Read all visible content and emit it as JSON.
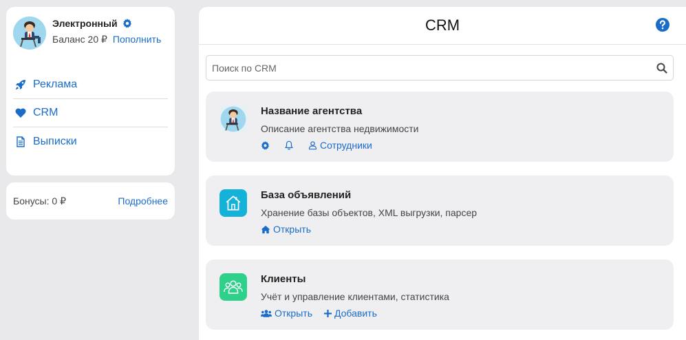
{
  "profile": {
    "name": "Электронный",
    "balance_label": "Баланс 20 ₽",
    "topup_label": "Пополнить"
  },
  "menu": {
    "items": [
      {
        "label": "Реклама",
        "icon": "rocket-icon"
      },
      {
        "label": "CRM",
        "icon": "heart-icon"
      },
      {
        "label": "Выписки",
        "icon": "document-icon"
      }
    ]
  },
  "bonus": {
    "text": "Бонусы: 0 ₽",
    "more_label": "Подробнее"
  },
  "main": {
    "title": "CRM",
    "search_placeholder": "Поиск по CRM",
    "items": [
      {
        "title": "Название агентства",
        "description": "Описание агентства недвижимости",
        "actions": [
          {
            "label": "",
            "icon": "gear-icon"
          },
          {
            "label": "",
            "icon": "bell-icon"
          },
          {
            "label": "Сотрудники",
            "icon": "user-icon"
          }
        ]
      },
      {
        "title": "База объявлений",
        "description": "Хранение базы объектов, XML выгрузки, парсер",
        "actions": [
          {
            "label": "Открыть",
            "icon": "home-icon"
          }
        ]
      },
      {
        "title": "Клиенты",
        "description": "Учёт и управление клиентами, статистика",
        "actions": [
          {
            "label": "Открыть",
            "icon": "users-icon"
          },
          {
            "label": "Добавить",
            "icon": "plus-icon"
          }
        ]
      }
    ]
  },
  "colors": {
    "link": "#1a6cc9",
    "background": "#e9e9ec",
    "card": "#ffffff",
    "item_bg": "#efeff1",
    "base_icon_bg": "#14b2d8",
    "clients_icon_bg": "#2fd18a"
  }
}
